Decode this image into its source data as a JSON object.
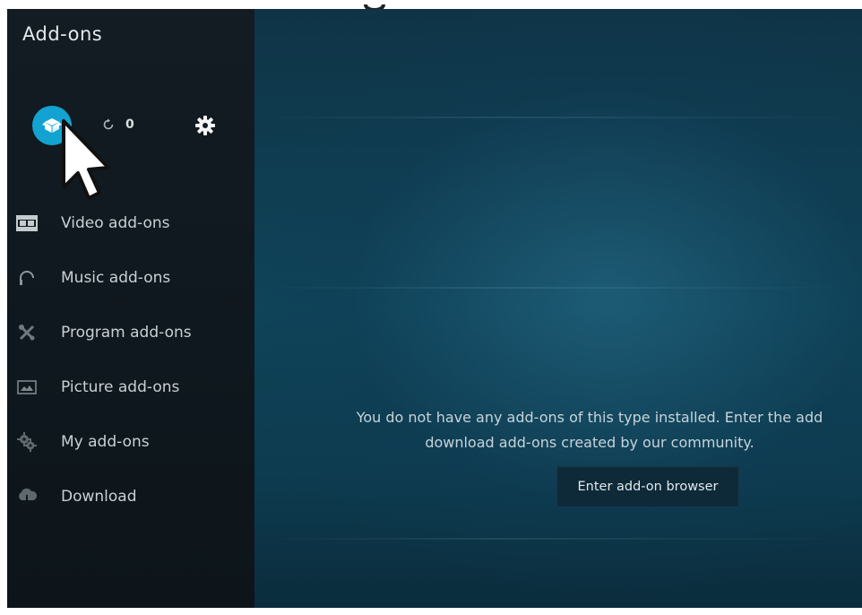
{
  "header": {
    "title": "Add-ons"
  },
  "toolbar": {
    "addons_icon": "open-box-icon",
    "update_icon": "refresh-icon",
    "update_count": "0",
    "settings_icon": "gear-icon"
  },
  "menu": {
    "items": [
      {
        "label": "Video add-ons",
        "icon": "film-strip-icon"
      },
      {
        "label": "Music add-ons",
        "icon": "headphones-icon"
      },
      {
        "label": "Program add-ons",
        "icon": "tools-icon"
      },
      {
        "label": "Picture add-ons",
        "icon": "picture-icon"
      },
      {
        "label": "My add-ons",
        "icon": "gears-icon"
      },
      {
        "label": "Download",
        "icon": "download-cloud-icon"
      }
    ]
  },
  "main": {
    "message_line1": "You do not have any add-ons of this type installed. Enter the add",
    "message_line2": "download add-ons created by our community.",
    "browser_button": "Enter add-on browser"
  },
  "colors": {
    "accent": "#12a3d2",
    "sidebar_bg": "#121c22",
    "main_bg": "#0f4459"
  }
}
